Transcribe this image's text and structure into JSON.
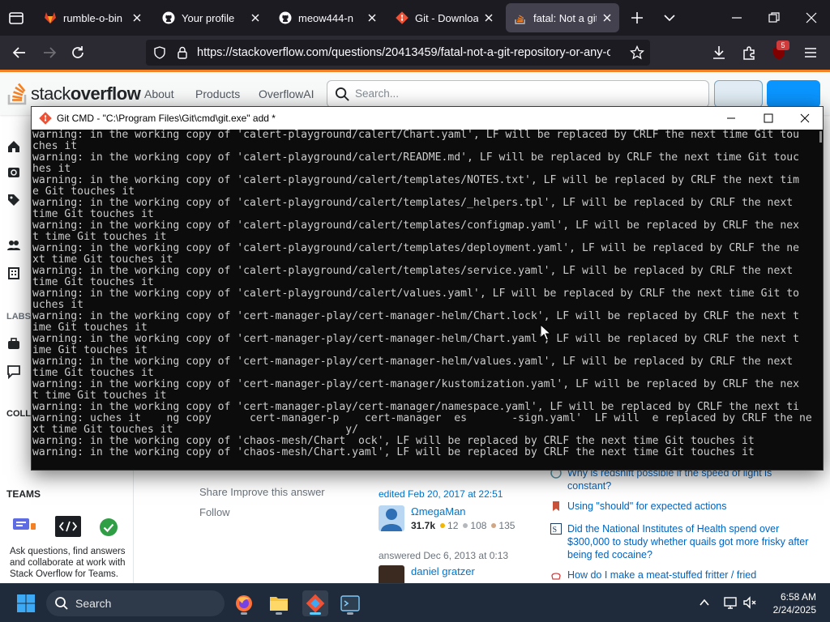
{
  "browser": {
    "tabs": [
      {
        "label": "rumble-o-bin · G",
        "icon": "gitlab-fox-icon"
      },
      {
        "label": "Your profile",
        "icon": "github-icon"
      },
      {
        "label": "meow444-n",
        "icon": "github-icon"
      },
      {
        "label": "Git - Downloadi",
        "icon": "git-icon"
      },
      {
        "label": "fatal: Not a git r",
        "icon": "stackoverflow-icon",
        "active": true
      }
    ],
    "url": "https://stackoverflow.com/questions/20413459/fatal-not-a-git-repository-or-any-of-th",
    "extension_badge": "5"
  },
  "stackoverflow": {
    "logo_light": "stack",
    "logo_bold": "overflow",
    "nav": [
      "About",
      "Products",
      "OverflowAI"
    ],
    "search_placeholder": "Search...",
    "left_labels": {
      "labs": "LABS",
      "collectives": "COLLE",
      "teams": "TEAMS"
    },
    "teams_desc": "Ask questions, find answers and collaborate at work with Stack Overflow for Teams.",
    "share_links": "Share  Improve this answer",
    "follow": "Follow",
    "edited": "edited Feb 20, 2017 at 22:51",
    "user1": {
      "name": "ΩmegaMan",
      "rep": "31.7k",
      "gold": "12",
      "silver": "108",
      "bronze": "135"
    },
    "answered": "answered Dec 6, 2013 at 0:13",
    "user2": {
      "name": "daniel gratzer"
    },
    "hot": [
      "Why is redshift possible if the speed of light is constant?",
      "Using \"should\" for expected actions",
      "Did the National Institutes of Health spend over $300,000 to study whether quails got more frisky after being fed cocaine?",
      "How do I make a meat-stuffed fritter / fried"
    ]
  },
  "cmd": {
    "title": "Git CMD - \"C:\\Program Files\\Git\\cmd\\git.exe\"  add *",
    "lines": [
      "warning: in the working copy of 'calert-playground/calert/Chart.yaml', LF will be replaced by CRLF the next time Git tou",
      "ches it",
      "warning: in the working copy of 'calert-playground/calert/README.md', LF will be replaced by CRLF the next time Git touc",
      "hes it",
      "warning: in the working copy of 'calert-playground/calert/templates/NOTES.txt', LF will be replaced by CRLF the next tim",
      "e Git touches it",
      "warning: in the working copy of 'calert-playground/calert/templates/_helpers.tpl', LF will be replaced by CRLF the next",
      "time Git touches it",
      "warning: in the working copy of 'calert-playground/calert/templates/configmap.yaml', LF will be replaced by CRLF the nex",
      "t time Git touches it",
      "warning: in the working copy of 'calert-playground/calert/templates/deployment.yaml', LF will be replaced by CRLF the ne",
      "xt time Git touches it",
      "warning: in the working copy of 'calert-playground/calert/templates/service.yaml', LF will be replaced by CRLF the next",
      "time Git touches it",
      "warning: in the working copy of 'calert-playground/calert/values.yaml', LF will be replaced by CRLF the next time Git to",
      "uches it",
      "warning: in the working copy of 'cert-manager-play/cert-manager-helm/Chart.lock', LF will be replaced by CRLF the next t",
      "ime Git touches it",
      "warning: in the working copy of 'cert-manager-play/cert-manager-helm/Chart.yaml', LF will be replaced by CRLF the next t",
      "ime Git touches it",
      "warning: in the working copy of 'cert-manager-play/cert-manager-helm/values.yaml', LF will be replaced by CRLF the next",
      "time Git touches it",
      "warning: in the working copy of 'cert-manager-play/cert-manager/kustomization.yaml', LF will be replaced by CRLF the nex",
      "t time Git touches it",
      "warning: in the working copy of 'cert-manager-play/cert-manager/namespace.yaml', LF will be replaced by CRLF the next ti",
      "warning: uches it    ng copy      cert-manager-p    cert-manager  es       -sign.yaml'  LF will  e replaced by CRLF the ne",
      "xt time Git touches it                           y/",
      "warning: in the working copy of 'chaos-mesh/Chart  ock', LF will be replaced by CRLF the next time Git touches it",
      "warning: in the working copy of 'chaos-mesh/Chart.yaml', LF will be replaced by CRLF the next time Git touches it"
    ]
  },
  "taskbar": {
    "search_label": "Search",
    "time": "6:58 AM",
    "date": "2/24/2025"
  },
  "colors": {
    "so_orange": "#f48225",
    "link_blue": "#0074cc",
    "console_bg": "#0c0c0c",
    "console_fg": "#cccccc"
  }
}
